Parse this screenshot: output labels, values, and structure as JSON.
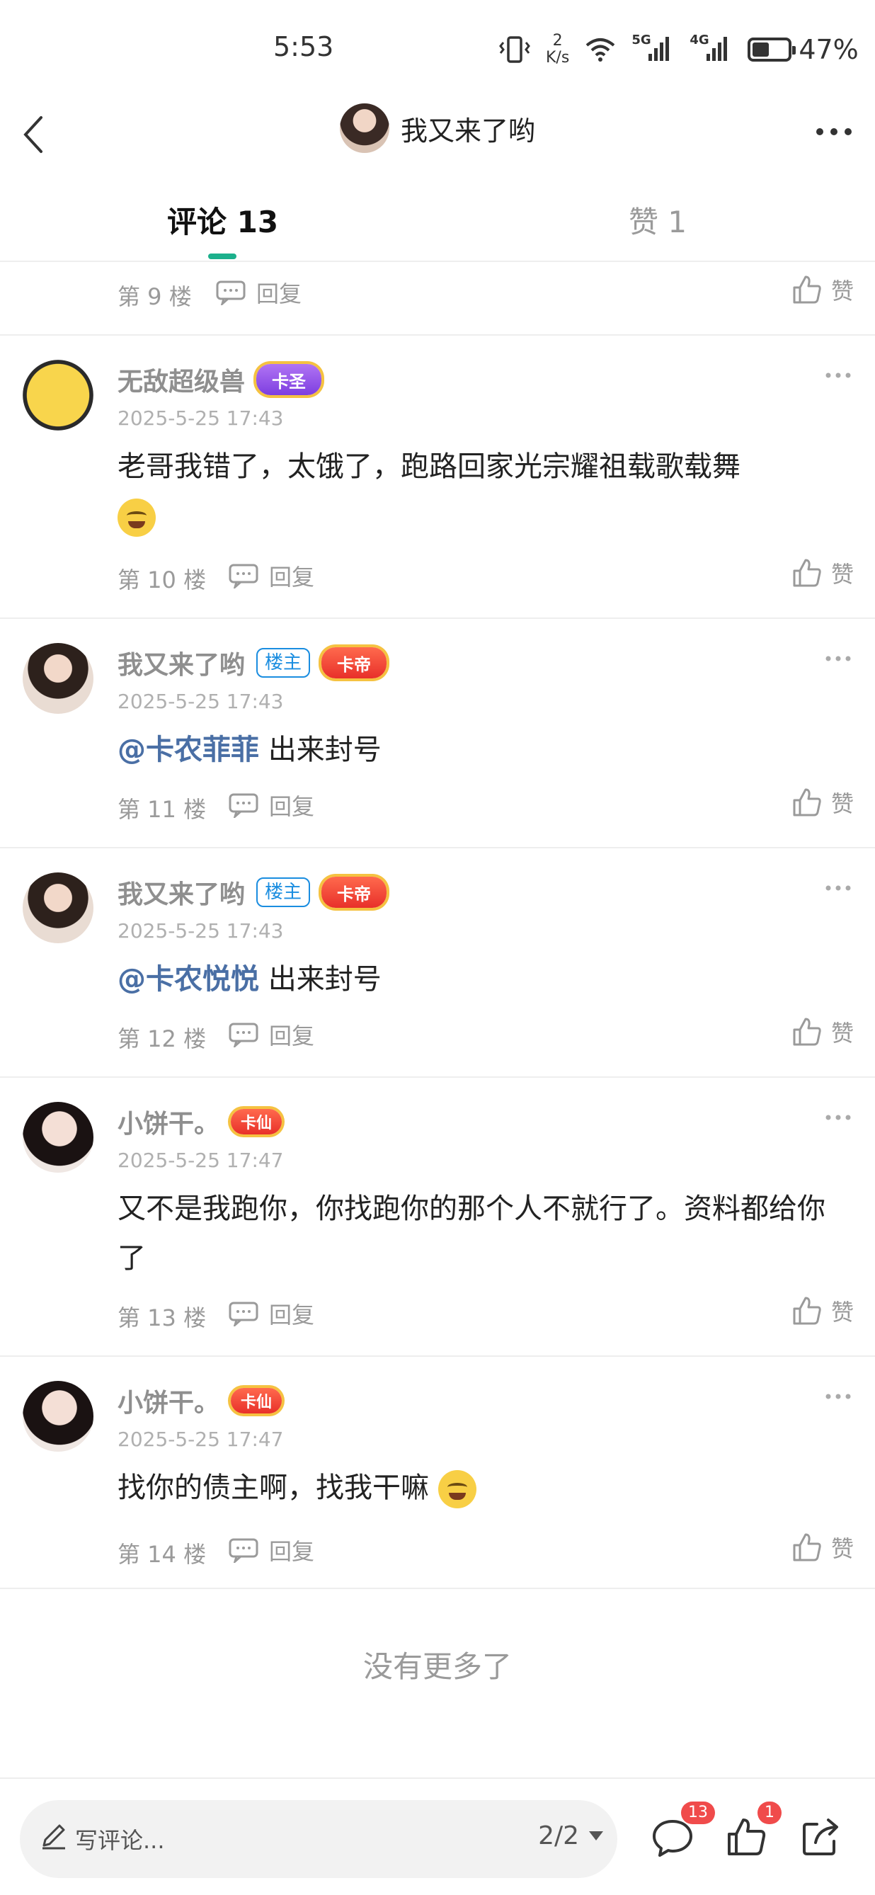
{
  "status_bar": {
    "time": "5:53",
    "net_speed_value": "2",
    "net_speed_unit": "K/s",
    "sig1": "5G",
    "sig2": "4G",
    "battery": "47%"
  },
  "header": {
    "title": "我又来了哟"
  },
  "tabs": {
    "comments": "评论 13",
    "likes": "赞 1"
  },
  "common": {
    "reply_label": "回复",
    "like_label": "赞"
  },
  "top_partial": {
    "floor": "第 9 楼"
  },
  "comments": [
    {
      "username": "无敌超级兽",
      "card_badge": "卡圣",
      "owner_badge": "",
      "date": "2025-5-25 17:43",
      "text": "老哥我错了，太饿了，跑路回家光宗耀祖载歌载舞",
      "floor": "第 10 楼"
    },
    {
      "username": "我又来了哟",
      "card_badge": "卡帝",
      "owner_badge": "楼主",
      "date": "2025-5-25 17:43",
      "mention": "@卡农菲菲",
      "text": " 出来封号",
      "floor": "第 11 楼"
    },
    {
      "username": "我又来了哟",
      "card_badge": "卡帝",
      "owner_badge": "楼主",
      "date": "2025-5-25 17:43",
      "mention": "@卡农悦悦",
      "text": " 出来封号",
      "floor": "第 12 楼"
    },
    {
      "username": "小饼干。",
      "card_badge": "卡仙",
      "owner_badge": "",
      "date": "2025-5-25 17:47",
      "text": "又不是我跑你，你找跑你的那个人不就行了。资料都给你了",
      "floor": "第 13 楼"
    },
    {
      "username": "小饼干。",
      "card_badge": "卡仙",
      "owner_badge": "",
      "date": "2025-5-25 17:47",
      "text": "找你的债主啊，找我干嘛",
      "floor": "第 14 楼"
    }
  ],
  "footer": {
    "no_more": "没有更多了"
  },
  "bottom_bar": {
    "placeholder": "写评论...",
    "pager": "2/2",
    "comment_count": "13",
    "like_count": "1"
  },
  "colors": {
    "accent": "#1cb08c",
    "mention": "#4a6fa5",
    "owner_badge": "#1a8de0",
    "notification": "#f04b4b"
  }
}
